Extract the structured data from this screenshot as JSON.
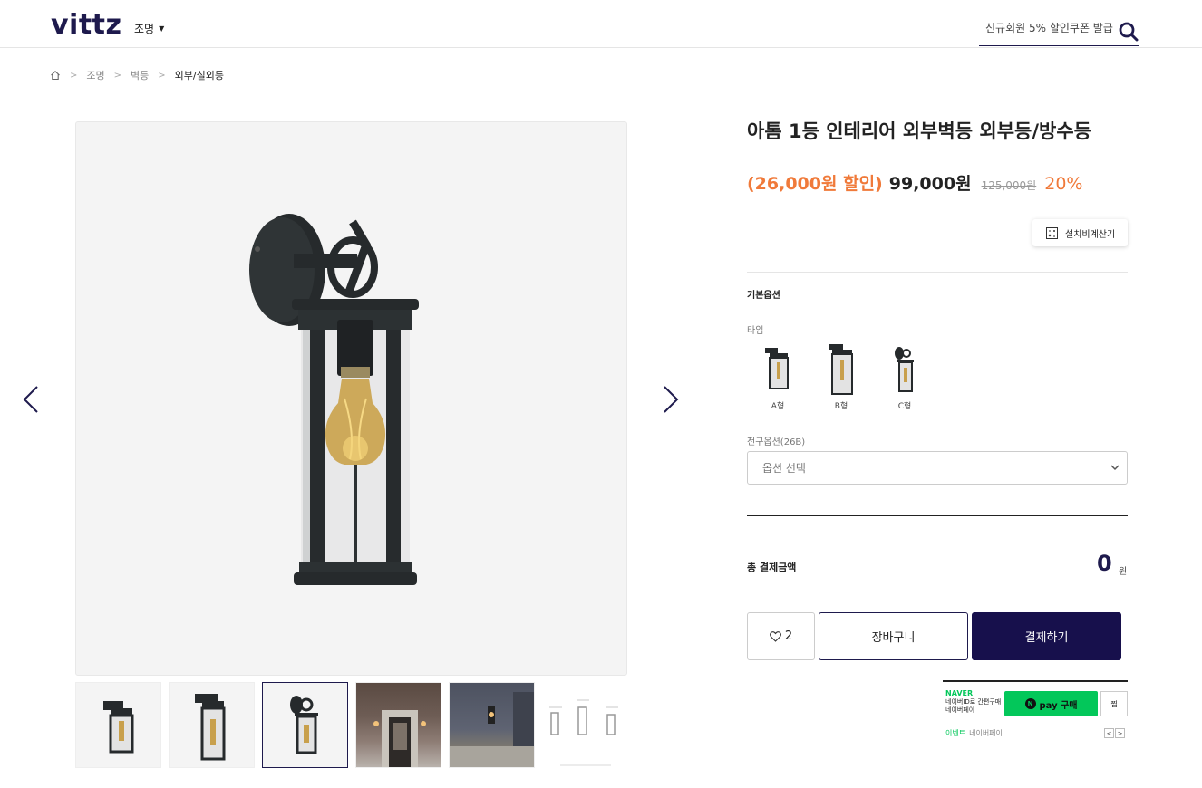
{
  "header": {
    "logo": "vittz",
    "category_menu": "조명",
    "search_placeholder": "신규회원 5% 할인쿠폰 발급"
  },
  "breadcrumb": {
    "items": [
      "조명",
      "벽등"
    ],
    "current": "외부/실외등"
  },
  "gallery": {
    "thumbnails": [
      "A형",
      "B형",
      "C형",
      "설치사진1",
      "설치사진2",
      "사이즈"
    ]
  },
  "product": {
    "title": "아톰 1등 인테리어 외부벽등 외부등/방수등",
    "discount_amount": "(26,000원 할인)",
    "sale_price": "99,000원",
    "original_price": "125,000원",
    "discount_rate": "20%"
  },
  "calc_button": "설치비계산기",
  "options": {
    "section_label": "기본옵션",
    "type_label": "타입",
    "types": [
      {
        "label": "A형"
      },
      {
        "label": "B형"
      },
      {
        "label": "C형"
      }
    ],
    "bulb_label": "전구옵션(26B)",
    "select_placeholder": "옵션 선택"
  },
  "total": {
    "label": "총 결제금액",
    "amount": "0",
    "unit": "원"
  },
  "actions": {
    "wish_count": "2",
    "cart_label": "장바구니",
    "buy_label": "결제하기"
  },
  "naver_pay": {
    "brand": "NAVER",
    "desc": "네이버ID로 간편구매 네이버페이",
    "buy_label": "pay 구매",
    "wish_label": "찜",
    "event_tag": "이벤트",
    "event_text": "네이버페이"
  },
  "colors": {
    "brand_navy": "#1e1a4d",
    "buy_button": "#17104c",
    "discount_orange": "#f07a3a",
    "naver_green": "#03c75a"
  }
}
